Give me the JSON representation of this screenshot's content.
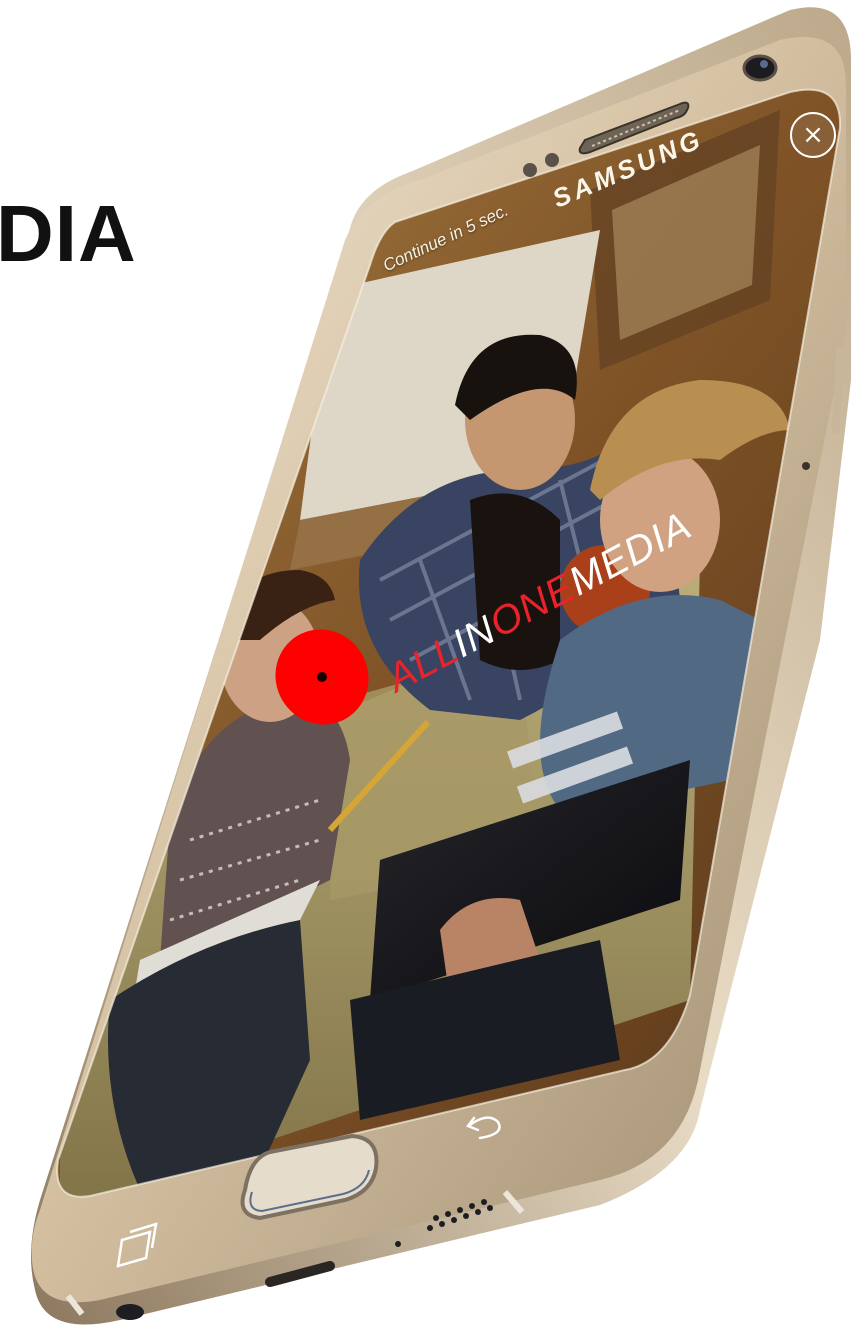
{
  "page": {
    "heading": "DIA"
  },
  "device": {
    "brand": "SAMSUNG"
  },
  "ad": {
    "countdown_text": "Continue in 5 sec.",
    "close_symbol": "×",
    "logo": {
      "part1": "ALL",
      "part2": "IN",
      "part3": "ONE",
      "part4": "MEDIA"
    }
  },
  "icons": {
    "close": "close-icon",
    "back": "back-icon",
    "recent_apps": "recent-apps-icon",
    "home": "home-button-icon",
    "camera": "front-camera-icon",
    "speaker": "earpiece-icon"
  },
  "colors": {
    "frame_gold": "#d8c4a4",
    "logo_red": "#e8232a",
    "marker_red": "#ff0000",
    "heading": "#111111"
  }
}
